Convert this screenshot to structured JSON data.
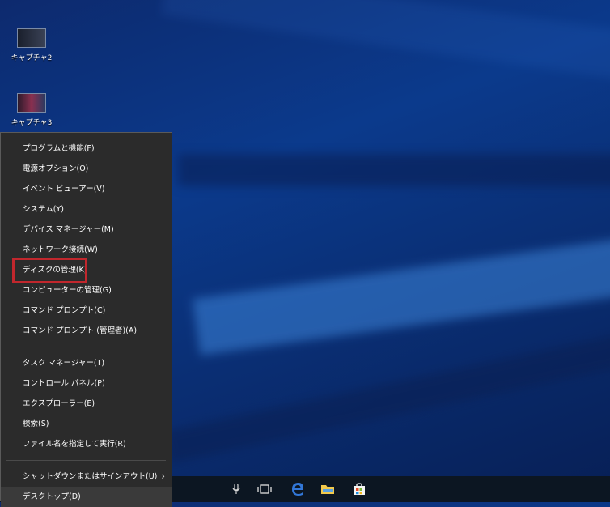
{
  "desktop": {
    "icons": [
      {
        "label": "キャプチャ2"
      },
      {
        "label": "キャプチャ3"
      }
    ]
  },
  "menu": {
    "group1": [
      {
        "label": "プログラムと機能(F)"
      },
      {
        "label": "電源オプション(O)"
      },
      {
        "label": "イベント ビューアー(V)"
      },
      {
        "label": "システム(Y)"
      },
      {
        "label": "デバイス マネージャー(M)"
      },
      {
        "label": "ネットワーク接続(W)"
      },
      {
        "label": "ディスクの管理(K)"
      },
      {
        "label": "コンピューターの管理(G)"
      },
      {
        "label": "コマンド プロンプト(C)"
      },
      {
        "label": "コマンド プロンプト (管理者)(A)"
      }
    ],
    "group2": [
      {
        "label": "タスク マネージャー(T)"
      },
      {
        "label": "コントロール パネル(P)"
      },
      {
        "label": "エクスプローラー(E)"
      },
      {
        "label": "検索(S)"
      },
      {
        "label": "ファイル名を指定して実行(R)"
      }
    ],
    "group3": [
      {
        "label": "シャットダウンまたはサインアウト(U)"
      },
      {
        "label": "デスクトップ(D)"
      }
    ],
    "highlight_color": "#c1272d"
  },
  "taskbar": {
    "icons": [
      "microphone-icon",
      "task-view-icon",
      "edge-icon",
      "file-explorer-icon",
      "store-icon"
    ]
  }
}
